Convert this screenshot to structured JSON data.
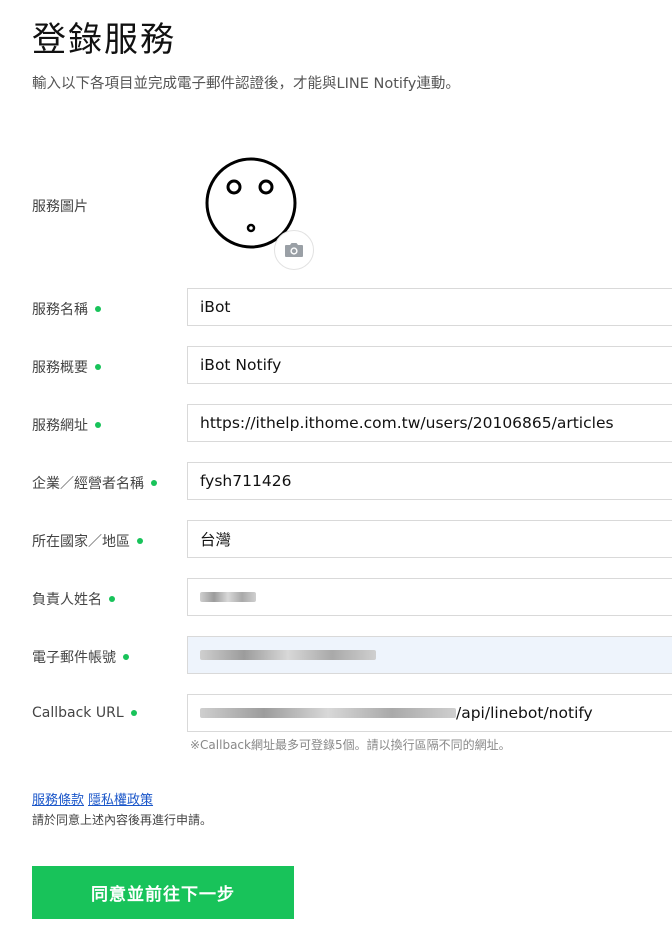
{
  "header": {
    "title": "登錄服務",
    "subtitle": "輸入以下各項目並完成電子郵件認證後，才能與LINE Notify連動。"
  },
  "form": {
    "image_label": "服務圖片",
    "camera_icon": "camera-icon",
    "fields": [
      {
        "label": "服務名稱",
        "value": "iBot"
      },
      {
        "label": "服務概要",
        "value": "iBot Notify"
      },
      {
        "label": "服務網址",
        "value": "https://ithelp.ithome.com.tw/users/20106865/articles"
      },
      {
        "label": "企業／經營者名稱",
        "value": "fysh711426"
      },
      {
        "label": "所在國家／地區",
        "value": "台灣"
      },
      {
        "label": "負責人姓名",
        "value": ""
      },
      {
        "label": "電子郵件帳號",
        "value": ""
      },
      {
        "label": "Callback URL",
        "value": "/api/linebot/notify"
      }
    ],
    "callback_note": "※Callback網址最多可登錄5個。請以換行區隔不同的網址。"
  },
  "footer": {
    "terms_link": "服務條款",
    "privacy_link": "隱私權政策",
    "agree_text": "請於同意上述內容後再進行申請。",
    "submit_label": "同意並前往下一步"
  },
  "colors": {
    "accent": "#18c35a",
    "link": "#1a56c9"
  }
}
